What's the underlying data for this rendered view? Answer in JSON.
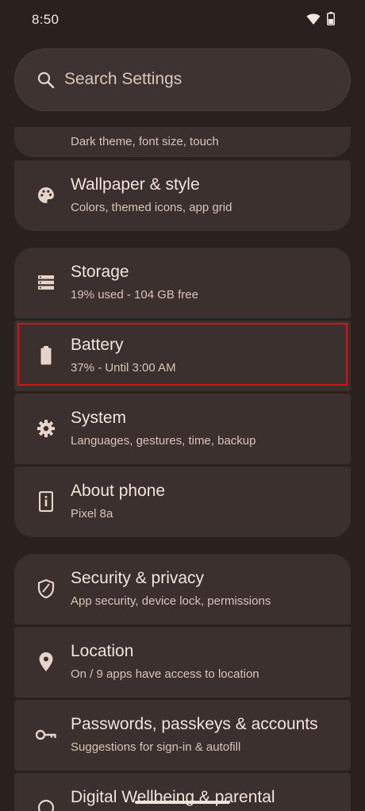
{
  "status_bar": {
    "time": "8:50",
    "icons": [
      "wifi-icon",
      "battery-icon"
    ]
  },
  "search": {
    "placeholder": "Search Settings",
    "icon": "search-icon"
  },
  "settings_items": [
    {
      "id": "display",
      "title": "",
      "subtitle": "Dark theme, font size, touch",
      "icon": "display-icon"
    },
    {
      "id": "wallpaper",
      "title": "Wallpaper & style",
      "subtitle": "Colors, themed icons, app grid",
      "icon": "palette-icon"
    },
    {
      "id": "storage",
      "title": "Storage",
      "subtitle": "19% used - 104 GB free",
      "icon": "storage-icon"
    },
    {
      "id": "battery",
      "title": "Battery",
      "subtitle": "37% - Until 3:00 AM",
      "icon": "battery-icon",
      "highlighted": true
    },
    {
      "id": "system",
      "title": "System",
      "subtitle": "Languages, gestures, time, backup",
      "icon": "gear-icon"
    },
    {
      "id": "about",
      "title": "About phone",
      "subtitle": "Pixel 8a",
      "icon": "info-icon"
    },
    {
      "id": "security",
      "title": "Security & privacy",
      "subtitle": "App security, device lock, permissions",
      "icon": "shield-icon"
    },
    {
      "id": "location",
      "title": "Location",
      "subtitle": "On / 9 apps have access to location",
      "icon": "location-pin-icon"
    },
    {
      "id": "passwords",
      "title": "Passwords, passkeys & accounts",
      "subtitle": "Suggestions for sign-in & autofill",
      "icon": "key-icon"
    },
    {
      "id": "wellbeing",
      "title": "Digital Wellbeing & parental",
      "subtitle": "",
      "icon": "wellbeing-icon"
    }
  ],
  "colors": {
    "background": "#2a201d",
    "card": "#3b302d",
    "highlight_border": "#c8181c",
    "title_text": "#f3e3dc",
    "subtitle_text": "#d8c3ba"
  }
}
